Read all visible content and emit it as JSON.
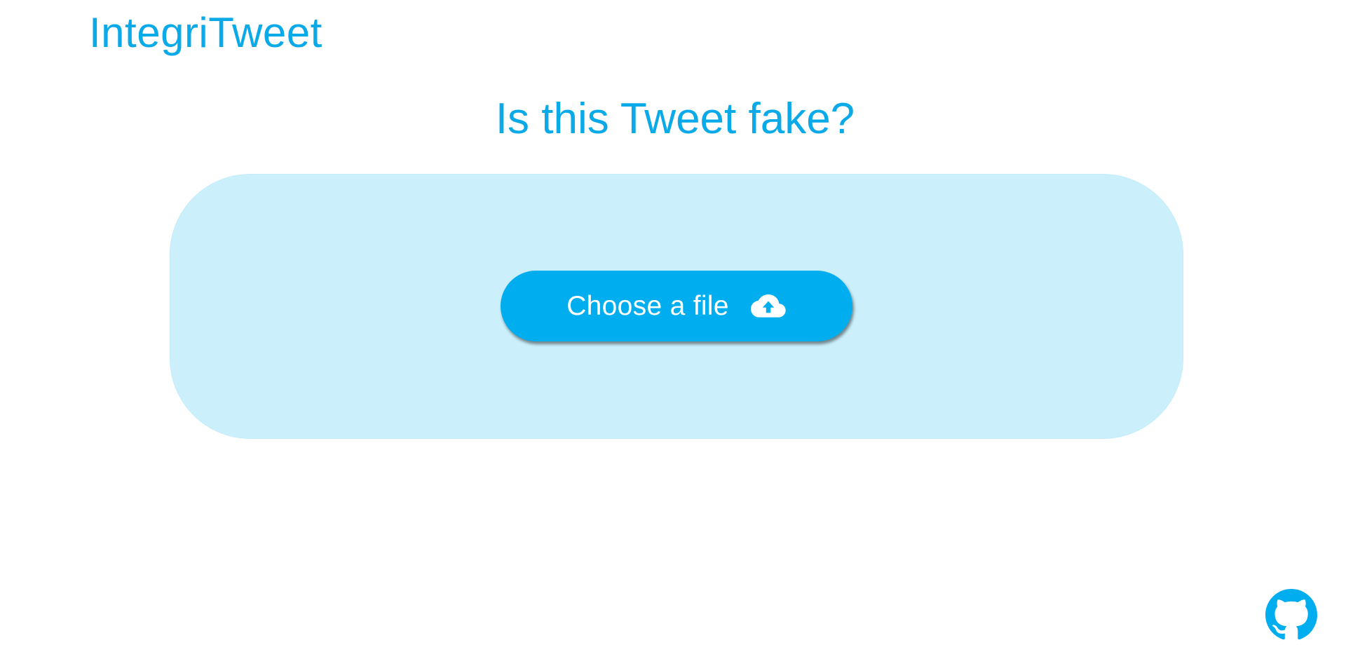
{
  "header": {
    "brand": "IntegriTweet"
  },
  "main": {
    "headline": "Is this Tweet fake?",
    "upload": {
      "label": "Choose a file",
      "icon": "cloud-upload-icon"
    }
  },
  "footer": {
    "github_icon": "github-icon"
  },
  "colors": {
    "accent": "#0aa9e8",
    "button": "#00adef",
    "dropzone": "#cbf0fc",
    "background": "#ffffff"
  }
}
